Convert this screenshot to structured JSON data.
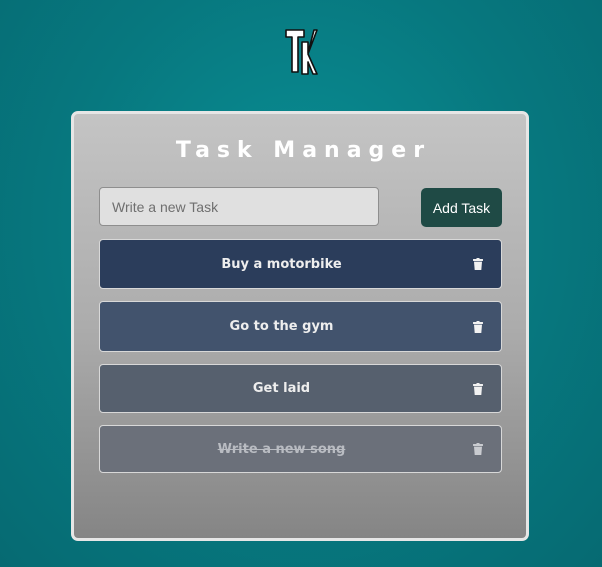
{
  "app": {
    "logo_icon": "tk-monogram-logo-icon",
    "title": "Task Manager"
  },
  "new_task": {
    "placeholder": "Write a new Task",
    "value": "",
    "add_label": "Add Task"
  },
  "tasks": [
    {
      "label": "Buy a motorbike",
      "completed": false,
      "icon": "trash-icon"
    },
    {
      "label": "Go to the gym",
      "completed": false,
      "icon": "trash-icon"
    },
    {
      "label": "Get laid",
      "completed": false,
      "icon": "trash-icon"
    },
    {
      "label": "Write a new song",
      "completed": true,
      "icon": "trash-icon"
    }
  ],
  "colors": {
    "background": "#07787f",
    "add_button": "#1f4a45",
    "task_1": "#2b3d5b",
    "task_2": "#42536d",
    "task_3": "#56606e",
    "task_4": "#6b707a"
  }
}
